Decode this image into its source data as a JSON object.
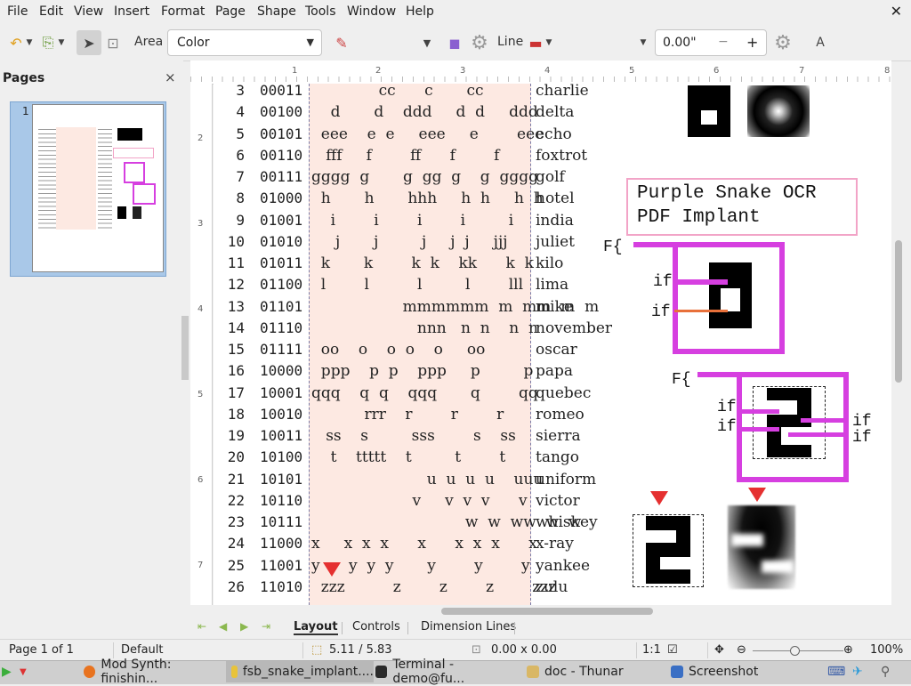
{
  "menu": [
    "File",
    "Edit",
    "View",
    "Insert",
    "Format",
    "Page",
    "Shape",
    "Tools",
    "Window",
    "Help"
  ],
  "toolbar": {
    "area_label": "Area",
    "area_fill": "Color",
    "line_label": "Line",
    "line_width": "0.00\"",
    "minus": "−",
    "plus": "+",
    "fill_color": "#6d96cf"
  },
  "sidebar": {
    "title": "Pages",
    "close": "×",
    "page_number": "1"
  },
  "ruler_h": [
    "1",
    "2",
    "3",
    "4",
    "5",
    "6",
    "7",
    "8"
  ],
  "ruler_v": [
    "2",
    "3",
    "4",
    "5",
    "6",
    "7"
  ],
  "rows": [
    {
      "n": "3",
      "bin": "00011",
      "glyph": "              cc      c       cc",
      "word": "charlie"
    },
    {
      "n": "4",
      "bin": "00100",
      "glyph": "    d       d    ddd     d  d     ddd",
      "word": "delta"
    },
    {
      "n": "5",
      "bin": "00101",
      "glyph": "  eee    e  e     eee     e        eee",
      "word": "echo"
    },
    {
      "n": "6",
      "bin": "00110",
      "glyph": "   fff     f        ff      f        f",
      "word": "foxtrot"
    },
    {
      "n": "7",
      "bin": "00111",
      "glyph": "gggg  g       g  gg  g    g  gggg",
      "word": "golf"
    },
    {
      "n": "8",
      "bin": "01000",
      "glyph": "  h       h       hhh     h  h     h  h",
      "word": "hotel"
    },
    {
      "n": "9",
      "bin": "01001",
      "glyph": "    i        i        i        i         i",
      "word": "india"
    },
    {
      "n": "10",
      "bin": "01010",
      "glyph": "     j       j         j     j  j     jjj",
      "word": "juliet"
    },
    {
      "n": "11",
      "bin": "01011",
      "glyph": "  k       k        k  k    kk      k  k",
      "word": "kilo"
    },
    {
      "n": "12",
      "bin": "01100",
      "glyph": "  l        l          l         l        lll",
      "word": "lima"
    },
    {
      "n": "13",
      "bin": "01101",
      "glyph": "                   mmmmmm  m  mm  m  m",
      "word": "mike"
    },
    {
      "n": "14",
      "bin": "01110",
      "glyph": "                      nnn   n  n    n  n",
      "word": "november"
    },
    {
      "n": "15",
      "bin": "01111",
      "glyph": "  oo    o    o  o    o     oo",
      "word": "oscar"
    },
    {
      "n": "16",
      "bin": "10000",
      "glyph": "  ppp    p  p    ppp     p         p",
      "word": "papa"
    },
    {
      "n": "17",
      "bin": "10001",
      "glyph": "qqq    q  q    qqq       q        qq",
      "word": "quebec"
    },
    {
      "n": "18",
      "bin": "10010",
      "glyph": "           rrr    r        r        r",
      "word": "romeo"
    },
    {
      "n": "19",
      "bin": "10011",
      "glyph": "   ss    s         sss        s    ss",
      "word": "sierra"
    },
    {
      "n": "20",
      "bin": "10100",
      "glyph": "    t    ttttt    t         t        t",
      "word": "tango"
    },
    {
      "n": "21",
      "bin": "10101",
      "glyph": "                        u  u  u  u    uuu",
      "word": "uniform"
    },
    {
      "n": "22",
      "bin": "10110",
      "glyph": "                     v     v  v  v      v",
      "word": "victor"
    },
    {
      "n": "23",
      "bin": "10111",
      "glyph": "                                w  w  ww  w  w",
      "word": "whiskey"
    },
    {
      "n": "24",
      "bin": "11000",
      "glyph": "x     x  x  x      x      x  x  x      x",
      "word": "x-ray"
    },
    {
      "n": "25",
      "bin": "11001",
      "glyph": "y      y  y  y       y        y        y",
      "word": "yankee"
    },
    {
      "n": "26",
      "bin": "11010",
      "glyph": "  zzz          z        z        z        zzz",
      "word": "zulu"
    }
  ],
  "ocr": {
    "line1": "Purple Snake OCR",
    "line2": "PDF Implant"
  },
  "code_labels": {
    "f1": "F{",
    "f2": "F{",
    "if": "if"
  },
  "tabs": [
    "Layout",
    "Controls",
    "Dimension Lines"
  ],
  "status": {
    "page": "Page 1 of 1",
    "style": "Default",
    "position": "5.11 / 5.83",
    "size": "0.00 x 0.00",
    "scale": "1:1",
    "zoom": "100%"
  },
  "taskbar": [
    {
      "label": "Mod Synth: finishin...",
      "icon": "firefox-icon",
      "color": "#e8731f"
    },
    {
      "label": "fsb_snake_implant....",
      "icon": "document-icon",
      "color": "#e8c33a"
    },
    {
      "label": "Terminal - demo@fu...",
      "icon": "terminal-icon",
      "color": "#2b2b2b"
    },
    {
      "label": "doc - Thunar",
      "icon": "folder-icon",
      "color": "#d9b765"
    },
    {
      "label": "Screenshot",
      "icon": "screenshot-icon",
      "color": "#3a6fc4"
    }
  ],
  "colors": {
    "accent": "#d63fe0",
    "pink_band": "#fde9e2",
    "marker": "#e53030",
    "selection": "#a9c8e8"
  }
}
